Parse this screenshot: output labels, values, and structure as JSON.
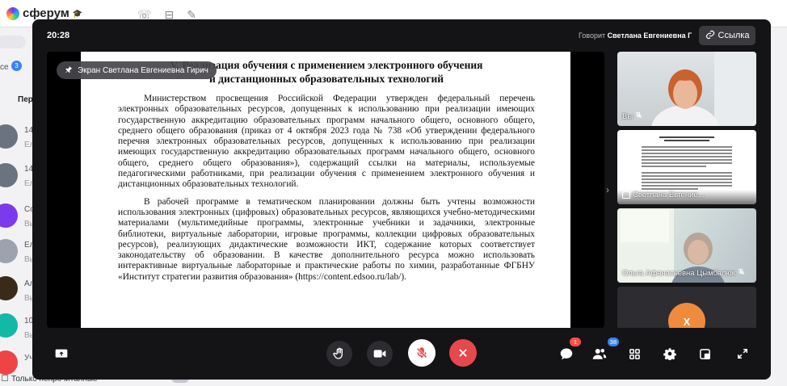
{
  "background_app": {
    "logo": "сферум",
    "sidebar_labels": [
      "се",
      "Пер",
      "14",
      "Ел",
      "14",
      "Ел",
      "Со",
      "Вь",
      "Ел",
      "Вы",
      "Ал",
      "Вы",
      "10",
      "Вы",
      "Уч"
    ],
    "badge_count": "3",
    "bottom_filter": "Только непрочитанные"
  },
  "call": {
    "time": "20:28",
    "speaker_prefix": "Говорит",
    "speaker_name": "Светлана Евгениевна Г",
    "link_label": "Ссылка",
    "share_label": "Экран Светлана Евгениевна Гирич"
  },
  "slide": {
    "title_line1": "V. Реализация обучения с применением электронного обучения",
    "title_line2": "и дистанционных образовательных технологий",
    "paragraph1": "Министерством просвещения Российской Федерации утвержден федеральный перечень электронных образовательных ресурсов, допущенных к использованию при реализации имеющих государственную аккредитацию образовательных программ начального общего, основного общего, среднего общего образования (приказ от 4 октября 2023 года № 738 «Об утверждении федерального перечня электронных образовательных ресурсов, допущенных к использованию при реализации имеющих государственную аккредитацию образовательных программ начального общего, основного общего, среднего общего образования»), содержащий ссылки на материалы, используемые педагогическими работниками, при реализации обучения с применением электронного обучения и дистанционных образовательных технологий.",
    "paragraph2": "В рабочей программе в тематическом планировании должны быть учтены возможности использования электронных (цифровых) образовательных ресурсов, являющихся учебно-методическими материалами (мультимедийные программы, электронные учебники и задачники, электронные библиотеки, виртуальные лаборатории, игровые программы, коллекции цифровых образовательных ресурсов), реализующих дидактические возможности ИКТ, содержание которых соответствует законодательству об образовании. В качестве дополнительного ресурса можно использовать интерактивные виртуальные лабораторные и практические работы по химии, разработанные ФГБНУ «Институт стратегии развития образования» (https://content.edsoo.ru/lab/)."
  },
  "tiles": [
    {
      "name": "Вы"
    },
    {
      "name": "Светлана Евгение..."
    },
    {
      "name": "Ольга Афанасьевна Цымбалюк"
    },
    {
      "name": "",
      "avatar_letter": "Х"
    }
  ],
  "controls": {
    "chat_badge": "1",
    "participants_badge": "38"
  },
  "colors": {
    "end_call": "#e5484d",
    "modal_bg": "#141416",
    "avatar_orange": "#f08a3c",
    "badge_blue": "#3b82f6",
    "badge_red": "#ff4d4d"
  }
}
